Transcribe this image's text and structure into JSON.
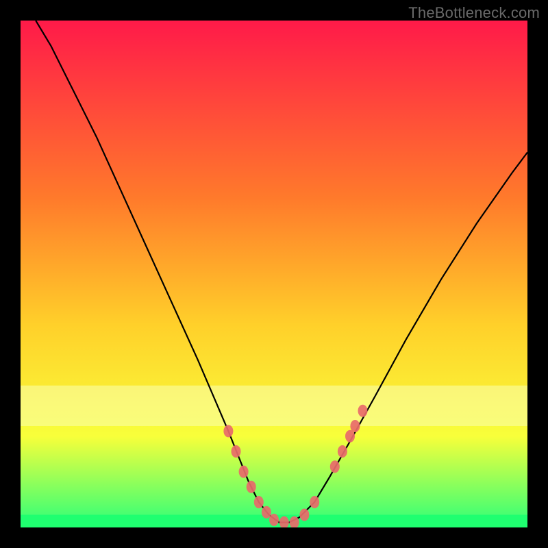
{
  "watermark": "TheBottleneck.com",
  "colors": {
    "bg_black": "#000000",
    "grad_top": "#ff1a49",
    "grad_mid1": "#ff7a2b",
    "grad_mid2": "#ffd02a",
    "grad_mid3": "#f8ff3a",
    "grad_bottom": "#2aff7a",
    "curve": "#000000",
    "pale_band": "#faffb0",
    "marker_fill": "#e86a6a",
    "marker_stroke": "#c94f4f"
  },
  "chart_data": {
    "type": "line",
    "title": "",
    "xlabel": "",
    "ylabel": "",
    "xlim": [
      0,
      100
    ],
    "ylim": [
      0,
      100
    ],
    "series": [
      {
        "name": "bottleneck-curve",
        "x": [
          3,
          6,
          10,
          15,
          20,
          25,
          30,
          35,
          38,
          41,
          43,
          45,
          47,
          49,
          51,
          53,
          55,
          58,
          61,
          65,
          70,
          76,
          83,
          90,
          97,
          100
        ],
        "y": [
          100,
          95,
          87,
          77,
          66,
          55,
          44,
          33,
          26,
          19,
          14,
          9,
          5,
          2.5,
          1,
          1,
          2,
          5,
          10,
          17,
          26,
          37,
          49,
          60,
          70,
          74
        ]
      }
    ],
    "markers": {
      "name": "highlight-points",
      "points": [
        {
          "x": 41,
          "y": 19
        },
        {
          "x": 42.5,
          "y": 15
        },
        {
          "x": 44,
          "y": 11
        },
        {
          "x": 45.5,
          "y": 8
        },
        {
          "x": 47,
          "y": 5
        },
        {
          "x": 48.5,
          "y": 3
        },
        {
          "x": 50,
          "y": 1.5
        },
        {
          "x": 52,
          "y": 1
        },
        {
          "x": 54,
          "y": 1
        },
        {
          "x": 56,
          "y": 2.5
        },
        {
          "x": 58,
          "y": 5
        },
        {
          "x": 62,
          "y": 12
        },
        {
          "x": 63.5,
          "y": 15
        },
        {
          "x": 65,
          "y": 18
        },
        {
          "x": 66,
          "y": 20
        },
        {
          "x": 67.5,
          "y": 23
        }
      ]
    },
    "bands": [
      {
        "name": "pale-yellow-band",
        "y0": 20,
        "y1": 28
      },
      {
        "name": "green-band",
        "y0": 0,
        "y1": 2.5
      }
    ]
  }
}
